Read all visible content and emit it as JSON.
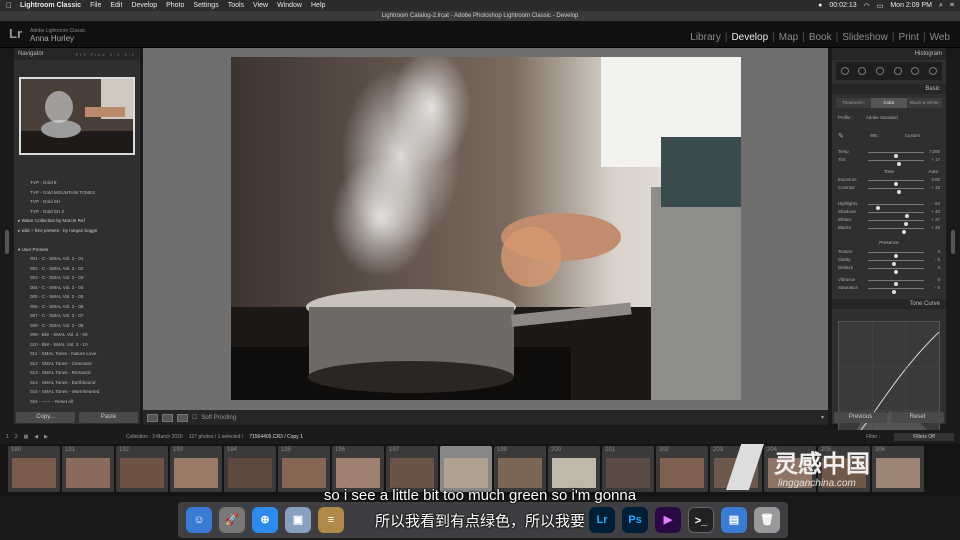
{
  "menubar": {
    "app": "Lightroom Classic",
    "items": [
      "File",
      "Edit",
      "Develop",
      "Photo",
      "Settings",
      "Tools",
      "View",
      "Window",
      "Help"
    ],
    "timer": "00:02:13",
    "clock": "Mon 2:09 PM"
  },
  "window_title": "Lightroom Catalog-2.lrcat - Adobe Photoshop Lightroom Classic - Develop",
  "identity": {
    "logo": "Lr",
    "catalog_line": "Adobe Lightroom Classic",
    "user": "Anna Hurley"
  },
  "modules": [
    {
      "label": "Library",
      "active": false
    },
    {
      "label": "Develop",
      "active": true
    },
    {
      "label": "Map",
      "active": false
    },
    {
      "label": "Book",
      "active": false
    },
    {
      "label": "Slideshow",
      "active": false
    },
    {
      "label": "Print",
      "active": false
    },
    {
      "label": "Web",
      "active": false
    }
  ],
  "navigator": {
    "title": "Navigator",
    "zoom": "FIT  FILL  1:1  3:1"
  },
  "presets": [
    {
      "label": "TVP - Gold 8",
      "group": false
    },
    {
      "label": "TVP - Gold MOUNTAIN TONES",
      "group": false
    },
    {
      "label": "TVP - Gold SH",
      "group": false
    },
    {
      "label": "TVP - Gold SH 2",
      "group": false
    },
    {
      "label": "▸ Water Collection by Marcin Ref",
      "group": true
    },
    {
      "label": "▸ wild + free presets - by megan boggs",
      "group": true
    },
    {
      "label": "",
      "group": false
    },
    {
      "label": "▾ User Presets",
      "group": true
    },
    {
      "label": "001 - C - SMAL Vol. 2 - 01",
      "group": false
    },
    {
      "label": "002 - C - SMAL Vol. 2 - 02",
      "group": false
    },
    {
      "label": "003 - C - SMAL Vol. 2 - 03",
      "group": false
    },
    {
      "label": "004 - C - SMAL Vol. 2 - 04",
      "group": false
    },
    {
      "label": "005 - C - SMAL Vol. 2 - 05",
      "group": false
    },
    {
      "label": "006 - C - SMAL Vol. 2 - 06",
      "group": false
    },
    {
      "label": "007 - C - SMAL Vol. 2 - 07",
      "group": false
    },
    {
      "label": "008 - C - SMAL Vol. 2 - 08",
      "group": false
    },
    {
      "label": "009 - BW - SMAL Vol. 2 - 09",
      "group": false
    },
    {
      "label": "010 - BW - SMAL Vol. 2 - 10",
      "group": false
    },
    {
      "label": "011 - SMAL Tones - Nature Love",
      "group": false
    },
    {
      "label": "012 - SMAL Tones - Cinematic",
      "group": false
    },
    {
      "label": "013 - SMAL Tones - Romantic",
      "group": false
    },
    {
      "label": "014 - SMAL Tones - Earthbound",
      "group": false
    },
    {
      "label": "015 - SMAL Tones - Warmhearted",
      "group": false
    },
    {
      "label": "016 - ------ - Reset All",
      "group": false
    }
  ],
  "left_buttons": {
    "copy": "Copy...",
    "paste": "Paste"
  },
  "toolbar": {
    "soft_proofing": "Soft Proofing"
  },
  "right": {
    "histogram": "Histogram",
    "basic": "Basic",
    "treatment": [
      "Treatment :",
      "Color",
      "Black & White"
    ],
    "profile_label": "Profile :",
    "profile_value": "Adobe Standard",
    "wb_label": "WB :",
    "wb_value": "Custom",
    "sliders": [
      {
        "label": "Temp",
        "value": "7,000",
        "pos": 0.5
      },
      {
        "label": "Tint",
        "value": "+ 17",
        "pos": 0.55
      },
      {
        "label": "Exposure",
        "value": "0.00",
        "pos": 0.5
      },
      {
        "label": "Contrast",
        "value": "+ 15",
        "pos": 0.56
      },
      {
        "label": "Highlights",
        "value": "- 64",
        "pos": 0.18
      },
      {
        "label": "Shadows",
        "value": "+ 40",
        "pos": 0.7
      },
      {
        "label": "Whites",
        "value": "+ 37",
        "pos": 0.68
      },
      {
        "label": "Blacks",
        "value": "+ 28",
        "pos": 0.64
      },
      {
        "label": "Texture",
        "value": "0",
        "pos": 0.5
      },
      {
        "label": "Clarity",
        "value": "- 5",
        "pos": 0.47
      },
      {
        "label": "Dehaze",
        "value": "0",
        "pos": 0.5
      },
      {
        "label": "Vibrance",
        "value": "0",
        "pos": 0.5
      },
      {
        "label": "Saturation",
        "value": "- 5",
        "pos": 0.47
      }
    ],
    "tone_label": "Tone",
    "tone_auto": "Auto",
    "presence_label": "Presence",
    "tone_curve": "Tone Curve",
    "previous": "Previous",
    "reset": "Reset"
  },
  "filmstrip_bar": {
    "pages": [
      "1",
      "2"
    ],
    "collection": "Collection : 3 March 2020",
    "count": "127 photos / 1 selected /",
    "file": "71564405.CR3 / Copy 1",
    "filter_label": "Filter :",
    "filter_value": "Filters Off"
  },
  "frames": [
    "190",
    "191",
    "192",
    "193",
    "194",
    "195",
    "196",
    "197",
    "198",
    "199",
    "200",
    "201",
    "202",
    "203",
    "204",
    "205",
    "206"
  ],
  "selected_frame": "198",
  "dock": [
    "Finder",
    "Launchpad",
    "Safari",
    "Preview",
    "Notes",
    "Lr",
    "Ps",
    "Premiere",
    "Terminal",
    "Finder",
    "Trash"
  ],
  "subtitles": {
    "en": "so i see a little bit too much green so i'm gonna",
    "cn": "所以我看到有点绿色，所以我要"
  },
  "watermark": {
    "cn": "灵感中国",
    "en": "lingganchina.com"
  },
  "colors": {
    "accent": "#e0e0e0",
    "ps": "#31a8ff",
    "lr": "#31a8ff"
  }
}
